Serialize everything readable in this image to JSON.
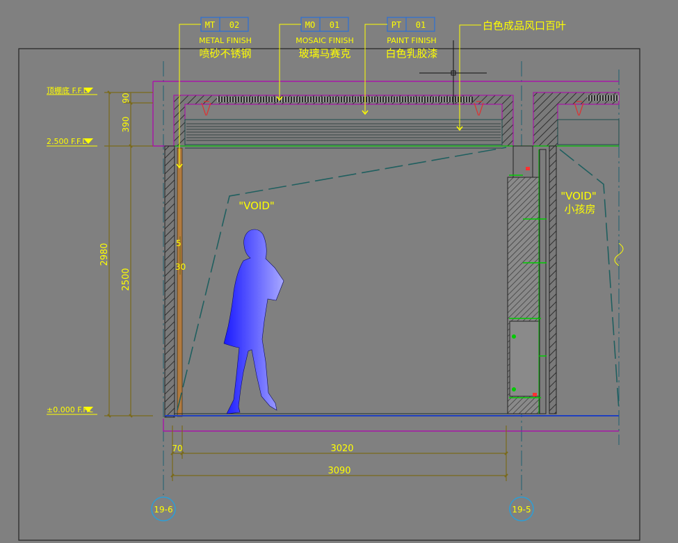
{
  "tags": [
    {
      "code": "MT",
      "num": "02",
      "finish": "METAL FINISH",
      "cn": "喷砂不锈钢"
    },
    {
      "code": "MO",
      "num": "01",
      "finish": "MOSAIC FINISH",
      "cn": "玻璃马赛克"
    },
    {
      "code": "PT",
      "num": "01",
      "finish": "PAINT FINISH",
      "cn": "白色乳胶漆"
    }
  ],
  "louver_note": "白色成品风口百叶",
  "levels": {
    "ceiling": "顶棚底 F.F.L",
    "mid": "2.500 F.F.L",
    "floor": "±0.000 F.F.L"
  },
  "vertical_dims": {
    "total": "2980",
    "main": "2500",
    "top1": "390",
    "top2": "90"
  },
  "wall_dims": {
    "d1": "5",
    "d2": "30"
  },
  "horizontal_dims": {
    "small": "70",
    "inner": "3020",
    "outer": "3090"
  },
  "void_left": "\"VOID\"",
  "void_right": "\"VOID\"",
  "room_right": "小孩房",
  "grid": {
    "left": "19-6",
    "right": "19-5"
  },
  "colors": {
    "background": "#808080",
    "annotation": "#ffff00",
    "dimension": "#7a6a1a",
    "outline": "#b000b0",
    "grid": "#2a9fd8",
    "floor_line": "#1f3fbf",
    "shelf": "#00cc00",
    "void_dash": "#1f5f5f"
  }
}
